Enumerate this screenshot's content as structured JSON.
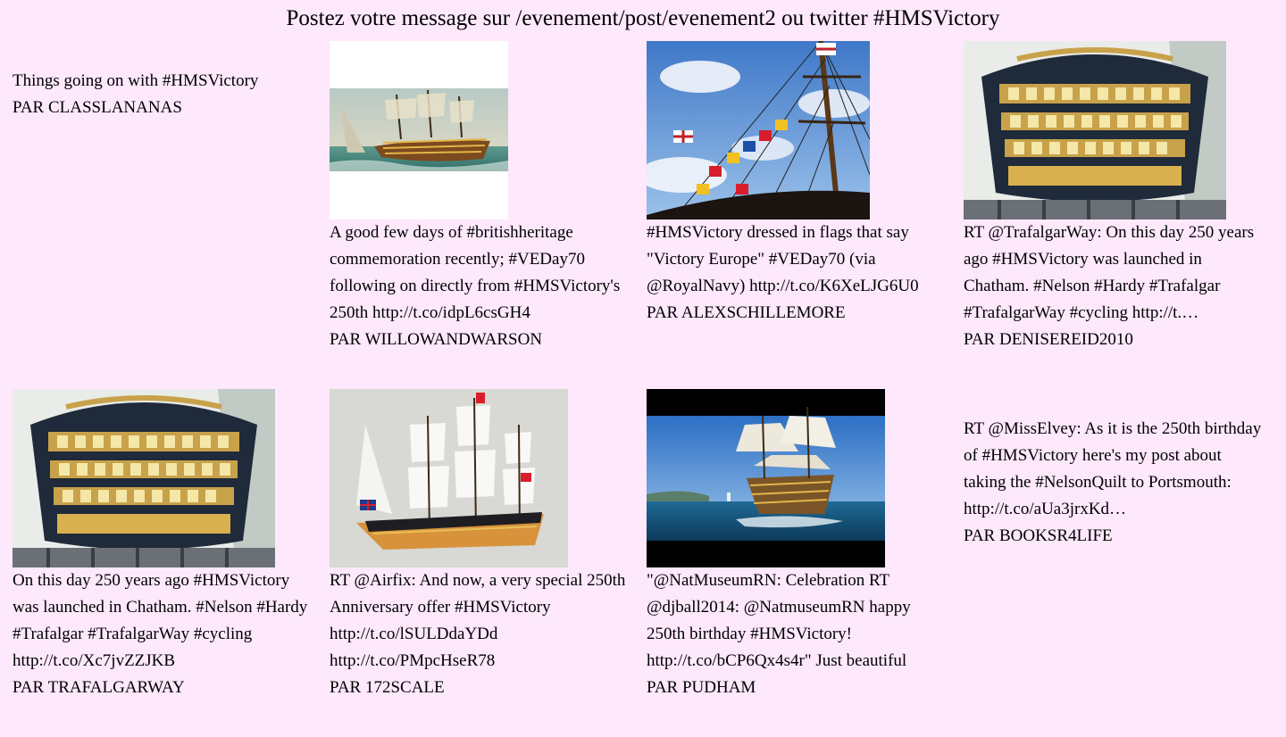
{
  "header": {
    "title": "Postez votre message sur /evenement/post/evenement2 ou twitter #HMSVictory"
  },
  "tweets": [
    {
      "text": "Things going on with #HMSVictory",
      "author": "PAR CLASSLANANAS"
    },
    {
      "text": "A good few days of #britishheritage commemoration recently; #VEDay70 following on directly from #HMSVictory's 250th http://t.co/idpL6csGH4",
      "author": "PAR WILLOWANDWARSON"
    },
    {
      "text": "#HMSVictory dressed in flags that say \"Victory Europe\" #VEDay70 (via @RoyalNavy) http://t.co/K6XeLJG6U0",
      "author": "PAR ALEXSCHILLEMORE"
    },
    {
      "text": "RT @TrafalgarWay: On this day 250 years ago #HMSVictory was launched in Chatham. #Nelson #Hardy #Trafalgar #TrafalgarWay #cycling http://t.…",
      "author": "PAR DENISEREID2010"
    },
    {
      "text": "On this day 250 years ago #HMSVictory was launched in Chatham. #Nelson #Hardy #Trafalgar #TrafalgarWay #cycling http://t.co/Xc7jvZZJKB",
      "author": "PAR TRAFALGARWAY"
    },
    {
      "text": "RT @Airfix: And now, a very special 250th Anniversary offer #HMSVictory http://t.co/lSULDdaYDd http://t.co/PMpcHseR78",
      "author": "PAR 172SCALE"
    },
    {
      "text": "\"@NatMuseumRN: Celebration RT @djball2014: @NatmuseumRN happy 250th birthday #HMSVictory! http://t.co/bCP6Qx4s4r\" Just beautiful",
      "author": "PAR PUDHAM"
    },
    {
      "text": "RT @MissElvey: As it is the 250th birthday of #HMSVictory here's my post about taking the #NelsonQuilt to Portsmouth: http://t.co/aUa3jrxKd…",
      "author": "PAR BOOKSR4LIFE"
    }
  ]
}
